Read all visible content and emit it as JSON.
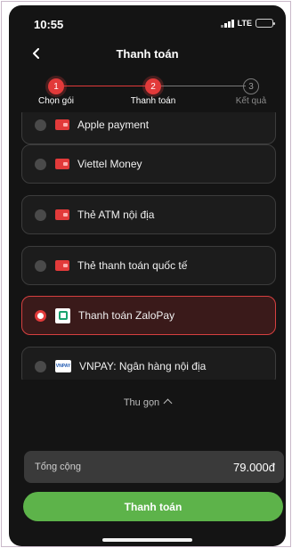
{
  "status_bar": {
    "time": "10:55",
    "network": "LTE",
    "battery_level": 0.6,
    "battery_color": "#f6d21f"
  },
  "header": {
    "title": "Thanh toán",
    "back_icon": "chevron-left-icon"
  },
  "stepper": {
    "steps": [
      {
        "number": "1",
        "label": "Chọn gói",
        "state": "done"
      },
      {
        "number": "2",
        "label": "Thanh toán",
        "state": "current"
      },
      {
        "number": "3",
        "label": "Kết quả",
        "state": "upcoming"
      }
    ],
    "accent": "#e23a3a"
  },
  "payment_methods": [
    {
      "label": "Apple payment",
      "icon": "wallet-icon",
      "selected": false
    },
    {
      "label": "Viettel Money",
      "icon": "wallet-icon",
      "selected": false
    },
    {
      "label": "Thẻ ATM nội địa",
      "icon": "wallet-icon",
      "selected": false
    },
    {
      "label": "Thẻ thanh toán quốc tế",
      "icon": "wallet-icon",
      "selected": false
    },
    {
      "label": "Thanh toán ZaloPay",
      "icon": "zalopay-icon",
      "selected": true
    },
    {
      "label": "VNPAY: Ngân hàng nội địa",
      "icon": "vnpay-icon",
      "selected": false
    }
  ],
  "collapse_label": "Thu gọn",
  "summary": {
    "total_label": "Tổng cộng",
    "total_value": "79.000đ"
  },
  "pay_button": {
    "label": "Thanh toán",
    "color": "#5db34a"
  }
}
